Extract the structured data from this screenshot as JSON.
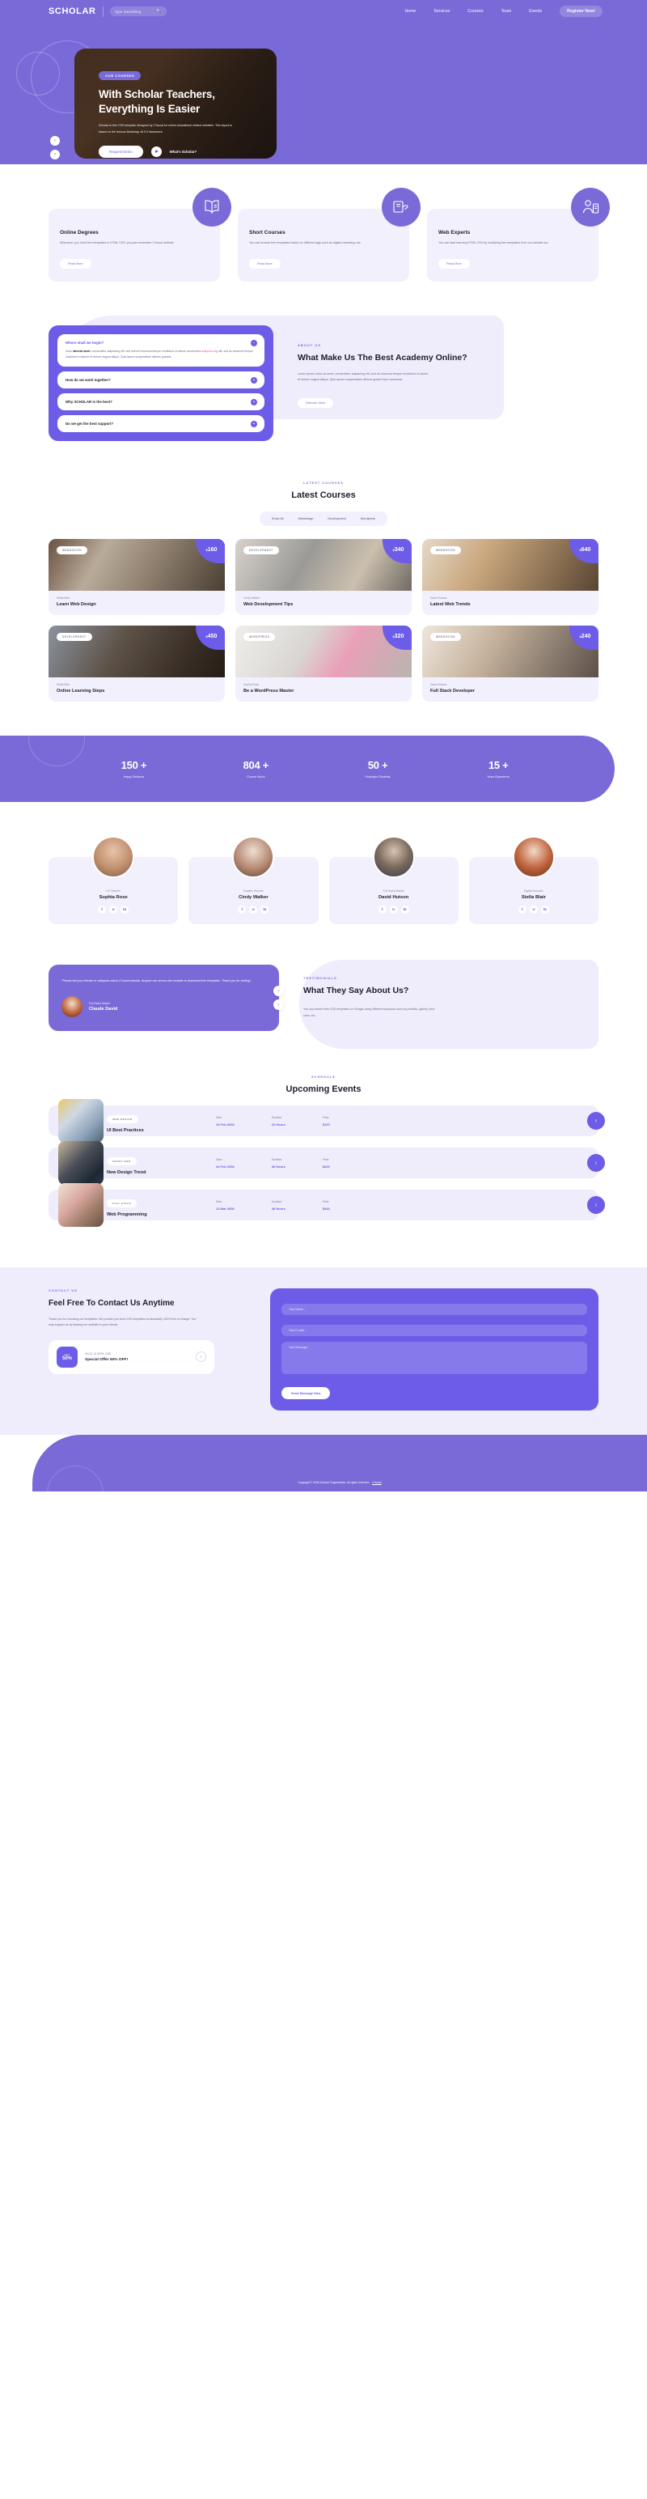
{
  "header": {
    "logo": "SCHOLAR",
    "search_placeholder": "Type Something",
    "search_icon": "search-icon",
    "nav": [
      {
        "label": "Home"
      },
      {
        "label": "Services"
      },
      {
        "label": "Courses"
      },
      {
        "label": "Team"
      },
      {
        "label": "Events"
      }
    ],
    "register_label": "Register Now!"
  },
  "hero": {
    "badge": "OUR COURSES",
    "title_line1": "With Scholar Teachers,",
    "title_line2": "Everything Is Easier",
    "description": "Scholar is free CSS template designed by 17sucai for online educational related websites. This layout is based on the famous Bootstrap v5.3.0 framework.",
    "cta_primary": "Request Demo",
    "video_label": "What's Scholar?",
    "play_icon": "play-icon",
    "prev_icon": "chevron-left-icon",
    "next_icon": "chevron-right-icon"
  },
  "services": [
    {
      "title": "Online Degrees",
      "text": "Whenever you need free templates in HTML CSS, you just remember 17sucai website.",
      "button": "Read More",
      "icon": "open-book-icon"
    },
    {
      "title": "Short Courses",
      "text": "You can browse free templates based on different tags such as digital marketing, etc.",
      "button": "Read More",
      "icon": "book-hand-icon"
    },
    {
      "title": "Web Experts",
      "text": "You can start learning HTML CSS by modifying free templates from our website too.",
      "button": "Read More",
      "icon": "teacher-icon"
    }
  ],
  "about": {
    "eyebrow": "ABOUT US",
    "heading": "What Make Us The Best Academy Online?",
    "paragraph": "Lorem ipsum dolor sit amet, consectetur adipiscing elit, sed do eiusmod tempor incididunt ut labore et dolore magna aliqua. Quis ipsum suspendisse ultrices gravid risus commodo.",
    "button": "Discover More",
    "accordion": [
      {
        "question": "Where shall we begin?",
        "open": true,
        "answer_p1": "Dolor ",
        "answer_b1": "almesit amet",
        "answer_p2": ", consectetur adipiscing elit, sed doesn't eiusmod tempor incididunt ut labore consectetur ",
        "answer_hl": "adipiscing",
        "answer_p3": " elit, sed do eiusmod tempor incididunt ut labore et dolore magna aliqua. Quis ipsum suspendisse ultrices gravida.",
        "toggle": "−"
      },
      {
        "question": "How do we work together?",
        "open": false,
        "toggle": "+"
      },
      {
        "question": "Why SCHOLAR is the best?",
        "open": false,
        "toggle": "+"
      },
      {
        "question": "Do we get the best support?",
        "open": false,
        "toggle": "+"
      }
    ]
  },
  "courses": {
    "eyebrow": "LATEST COURSES",
    "title": "Latest Courses",
    "filters": [
      "Show All",
      "Webdesign",
      "Development",
      "Wordpress"
    ],
    "items": [
      {
        "category": "WEBDESIGN",
        "price": "160",
        "currency": "$",
        "author": "Stella Blair",
        "name": "Learn Web Design"
      },
      {
        "category": "DEVELOPMENT",
        "price": "340",
        "currency": "$",
        "author": "Cindy Walker",
        "name": "Web Development Tips"
      },
      {
        "category": "WEBDESIGN",
        "price": "640",
        "currency": "$",
        "author": "David Hutson",
        "name": "Latest Web Trends"
      },
      {
        "category": "DEVELOPMENT",
        "price": "450",
        "currency": "$",
        "author": "Stella Blair",
        "name": "Online Learning Steps"
      },
      {
        "category": "WORDPRESS",
        "price": "320",
        "currency": "$",
        "author": "Sophia Rose",
        "name": "Be a WordPress Master"
      },
      {
        "category": "WEBDESIGN",
        "price": "240",
        "currency": "$",
        "author": "David Hutson",
        "name": "Full Stack Developer"
      }
    ]
  },
  "counters": [
    {
      "value": "150 +",
      "label": "Happy Students"
    },
    {
      "value": "804 +",
      "label": "Course Hours"
    },
    {
      "value": "50 +",
      "label": "Employed Students"
    },
    {
      "value": "15 +",
      "label": "Years Experience"
    }
  ],
  "team": [
    {
      "role": "UX Teacher",
      "name": "Sophia Rose",
      "socials": [
        "facebook-icon",
        "twitter-icon",
        "linkedin-icon"
      ]
    },
    {
      "role": "Graphic Teacher",
      "name": "Cindy Walker",
      "socials": [
        "facebook-icon",
        "twitter-icon",
        "linkedin-icon"
      ]
    },
    {
      "role": "Full Stack Master",
      "name": "David Hutson",
      "socials": [
        "facebook-icon",
        "twitter-icon",
        "linkedin-icon"
      ]
    },
    {
      "role": "Digital Animator",
      "name": "Stella Blair",
      "socials": [
        "facebook-icon",
        "twitter-icon",
        "linkedin-icon"
      ]
    }
  ],
  "testimonials": {
    "eyebrow": "TESTIMONIALS",
    "heading": "What They Say About Us?",
    "paragraph": "You can search free CSS templates on Google using different keywords such as portfolio, gallery, blue color, etc.",
    "quote": "\"Please tell your friends or collegues about 17sucai website. Anyone can access the website to download free templates. Thank you for visiting.\"",
    "person_role": "Full Stack Master",
    "person_name": "Claude David",
    "prev_icon": "chevron-left-icon",
    "next_icon": "chevron-right-icon"
  },
  "events": {
    "eyebrow": "SCHEDULE",
    "title": "Upcoming Events",
    "labels": {
      "date": "Date:",
      "duration": "Duration:",
      "price": "Price:"
    },
    "items": [
      {
        "category": "WEB DESIGN",
        "name": "UI Best Practices",
        "date": "16 Feb 2036",
        "duration": "22 Hours",
        "price": "$120"
      },
      {
        "category": "FRONT END",
        "name": "New Design Trend",
        "date": "24 Feb 2036",
        "duration": "36 Hours",
        "price": "$220"
      },
      {
        "category": "FULL STACK",
        "name": "Web Programming",
        "date": "12 Mar 2036",
        "duration": "48 Hours",
        "price": "$440"
      }
    ]
  },
  "contact": {
    "eyebrow": "CONTACT US",
    "heading": "Feel Free To Contact Us Anytime",
    "paragraph": "Thank you for choosing our templates. We provide you best CSS templates at absolutely 100% free of charge. You may support us by sharing our website to your friends.",
    "offer_badge_small": "GET",
    "offer_badge_big": "50%",
    "offer_validity": "VALID, 24 APRIL 2036",
    "offer_title": "Special Offer 50% OFF!",
    "offer_go_icon": "chevron-right-icon",
    "form": {
      "name_placeholder": "Your Name...",
      "email_placeholder": "Your E-mail...",
      "message_placeholder": "Your Message...",
      "submit_label": "Send Message Now"
    }
  },
  "footer": {
    "copyright": "Copyright © 2036 Scholar Organization. All rights reserved.",
    "credit": "17sucai"
  }
}
